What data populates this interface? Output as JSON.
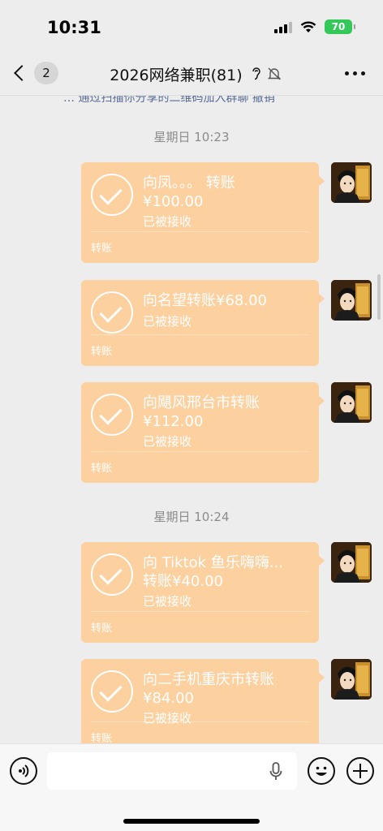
{
  "status_bar": {
    "time": "10:31",
    "battery": "70"
  },
  "nav": {
    "unread_count": "2",
    "title": "2026网络兼职(81)"
  },
  "chat": {
    "cut_notice": "… 通过扫描你分享的二维码加入群聊  撤销",
    "time_labels": [
      "星期日 10:23",
      "星期日 10:24"
    ],
    "transfers": [
      {
        "line1": "向凤。。。 转账",
        "line2": "¥100.00",
        "status": "已被接收",
        "footer": "转账"
      },
      {
        "line1": "向名望转账¥68.00",
        "line2": "",
        "status": "已被接收",
        "footer": "转账"
      },
      {
        "line1": "向飓风邢台市转账",
        "line2": "¥112.00",
        "status": "已被接收",
        "footer": "转账"
      },
      {
        "line1": "向 Tiktok 鱼乐嗨嗨...",
        "line2": "转账¥40.00",
        "status": "已被接收",
        "footer": "转账"
      },
      {
        "line1": "向二手机重庆市转账",
        "line2": "¥84.00",
        "status": "已被接收",
        "footer": "转账"
      }
    ]
  },
  "input_bar": {
    "placeholder": ""
  },
  "colors": {
    "card": "#fdd09f",
    "background": "#ededed",
    "battery": "#34c759"
  }
}
